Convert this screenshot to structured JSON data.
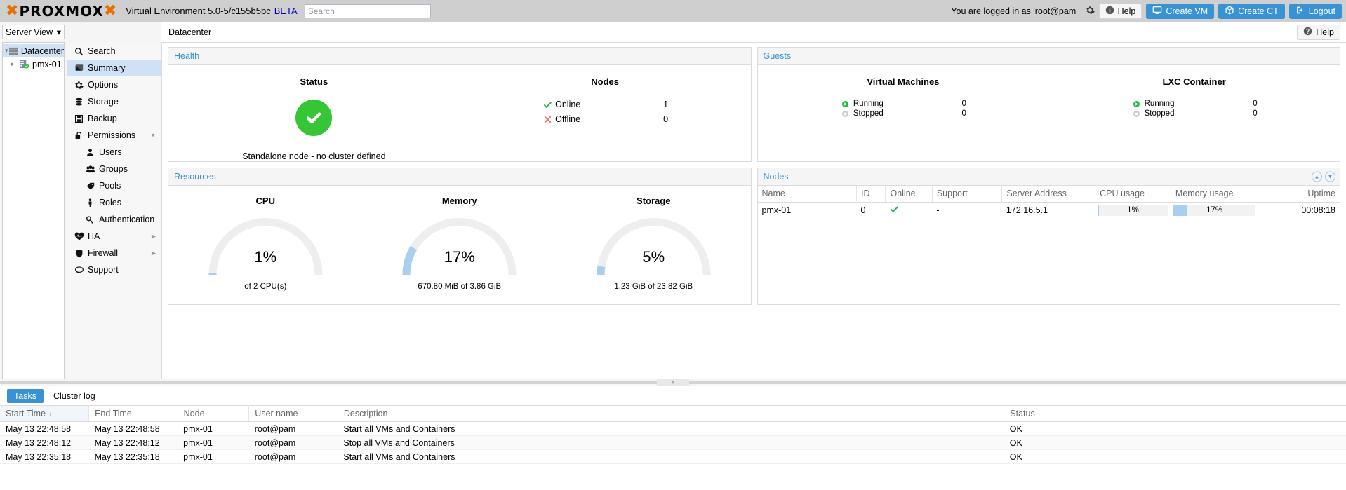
{
  "topbar": {
    "logo_text": "PROXMOX",
    "brand_text": "Virtual Environment 5.0-5/c155b5bc",
    "beta_label": "BETA",
    "search_placeholder": "Search",
    "search_value": "",
    "login_text": "You are logged in as 'root@pam'",
    "settings_icon": "gear-icon",
    "buttons": [
      {
        "label": "Help",
        "icon": "info-icon",
        "style": "light"
      },
      {
        "label": "Create VM",
        "icon": "monitor-icon",
        "style": "blue"
      },
      {
        "label": "Create CT",
        "icon": "box-icon",
        "style": "blue"
      },
      {
        "label": "Logout",
        "icon": "logout-icon",
        "style": "blue"
      }
    ]
  },
  "sidebar": {
    "view_selector": "Server View",
    "tree": [
      {
        "label": "Datacenter",
        "icon": "datacenter-icon",
        "selected": true,
        "expander": "expanded"
      },
      {
        "label": "pmx-01",
        "icon": "server-online-icon",
        "selected": false,
        "expander": "collapsed"
      }
    ]
  },
  "nav": {
    "items": [
      {
        "label": "Search",
        "icon": "search-icon",
        "selected": false,
        "sub": false
      },
      {
        "label": "Summary",
        "icon": "summary-icon",
        "selected": true,
        "sub": false
      },
      {
        "label": "Options",
        "icon": "gear-icon",
        "selected": false,
        "sub": false
      },
      {
        "label": "Storage",
        "icon": "storage-icon",
        "selected": false,
        "sub": false
      },
      {
        "label": "Backup",
        "icon": "save-icon",
        "selected": false,
        "sub": false
      },
      {
        "label": "Permissions",
        "icon": "unlock-icon",
        "selected": false,
        "sub": false,
        "arrow": "chevron-down-icon"
      },
      {
        "label": "Users",
        "icon": "user-icon",
        "selected": false,
        "sub": true
      },
      {
        "label": "Groups",
        "icon": "group-icon",
        "selected": false,
        "sub": true
      },
      {
        "label": "Pools",
        "icon": "tag-icon",
        "selected": false,
        "sub": true
      },
      {
        "label": "Roles",
        "icon": "person-icon",
        "selected": false,
        "sub": true
      },
      {
        "label": "Authentication",
        "icon": "key-icon",
        "selected": false,
        "sub": true
      },
      {
        "label": "HA",
        "icon": "heartbeat-icon",
        "selected": false,
        "sub": false,
        "arrow": "chevron-right-icon"
      },
      {
        "label": "Firewall",
        "icon": "shield-icon",
        "selected": false,
        "sub": false,
        "arrow": "chevron-right-icon"
      },
      {
        "label": "Support",
        "icon": "comment-icon",
        "selected": false,
        "sub": false
      }
    ]
  },
  "content_header": {
    "breadcrumb": "Datacenter",
    "help_label": "Help",
    "help_icon": "question-icon"
  },
  "health": {
    "panel_title": "Health",
    "status_title": "Status",
    "status_icon": "check-circle-icon",
    "standalone_note": "Standalone node - no cluster defined",
    "nodes_title": "Nodes",
    "rows": [
      {
        "icon": "check-icon",
        "label": "Online",
        "value": "1"
      },
      {
        "icon": "cross-icon",
        "label": "Offline",
        "value": "0"
      }
    ]
  },
  "guests": {
    "panel_title": "Guests",
    "groups": [
      {
        "title": "Virtual Machines",
        "rows": [
          {
            "icon": "play-icon",
            "label": "Running",
            "value": "0"
          },
          {
            "icon": "stop-icon",
            "label": "Stopped",
            "value": "0"
          }
        ]
      },
      {
        "title": "LXC Container",
        "rows": [
          {
            "icon": "play-icon",
            "label": "Running",
            "value": "0"
          },
          {
            "icon": "stop-icon",
            "label": "Stopped",
            "value": "0"
          }
        ]
      }
    ]
  },
  "resources": {
    "panel_title": "Resources",
    "gauges": [
      {
        "title": "CPU",
        "value_label": "1%",
        "percent": 1,
        "sub": "of 2 CPU(s)"
      },
      {
        "title": "Memory",
        "value_label": "17%",
        "percent": 17,
        "sub": "670.80 MiB of 3.86 GiB"
      },
      {
        "title": "Storage",
        "value_label": "5%",
        "percent": 5,
        "sub": "1.23 GiB of 23.82 GiB"
      }
    ],
    "track_color": "#eeeeee",
    "fill_color": "#a9cfee"
  },
  "nodes_panel": {
    "panel_title": "Nodes",
    "tools": [
      {
        "icon": "chevron-up-circle-icon"
      },
      {
        "icon": "chevron-down-circle-icon"
      }
    ],
    "columns": [
      "Name",
      "ID",
      "Online",
      "Support",
      "Server Address",
      "CPU usage",
      "Memory usage",
      "Uptime"
    ],
    "rows": [
      {
        "name": "pmx-01",
        "id": "0",
        "online_icon": "check-icon",
        "support": "-",
        "address": "172.16.5.1",
        "cpu_usage": "1%",
        "cpu_percent": 1,
        "memory_usage": "17%",
        "memory_percent": 17,
        "uptime": "00:08:18"
      }
    ]
  },
  "bottom": {
    "tabs": [
      {
        "label": "Tasks",
        "active": true
      },
      {
        "label": "Cluster log",
        "active": false
      }
    ],
    "columns": [
      "Start Time",
      "End Time",
      "Node",
      "User name",
      "Description",
      "Status"
    ],
    "sorted_column": "Start Time",
    "sort_direction": "↓",
    "rows": [
      {
        "start": "May 13 22:48:58",
        "end": "May 13 22:48:58",
        "node": "pmx-01",
        "user": "root@pam",
        "description": "Start all VMs and Containers",
        "status": "OK"
      },
      {
        "start": "May 13 22:48:12",
        "end": "May 13 22:48:12",
        "node": "pmx-01",
        "user": "root@pam",
        "description": "Stop all VMs and Containers",
        "status": "OK"
      },
      {
        "start": "May 13 22:35:18",
        "end": "May 13 22:35:18",
        "node": "pmx-01",
        "user": "root@pam",
        "description": "Start all VMs and Containers",
        "status": "OK"
      }
    ]
  },
  "colors": {
    "accent": "#3892d4",
    "ok_green": "#35c535",
    "error_red": "#f4776a",
    "orange": "#e57000"
  }
}
